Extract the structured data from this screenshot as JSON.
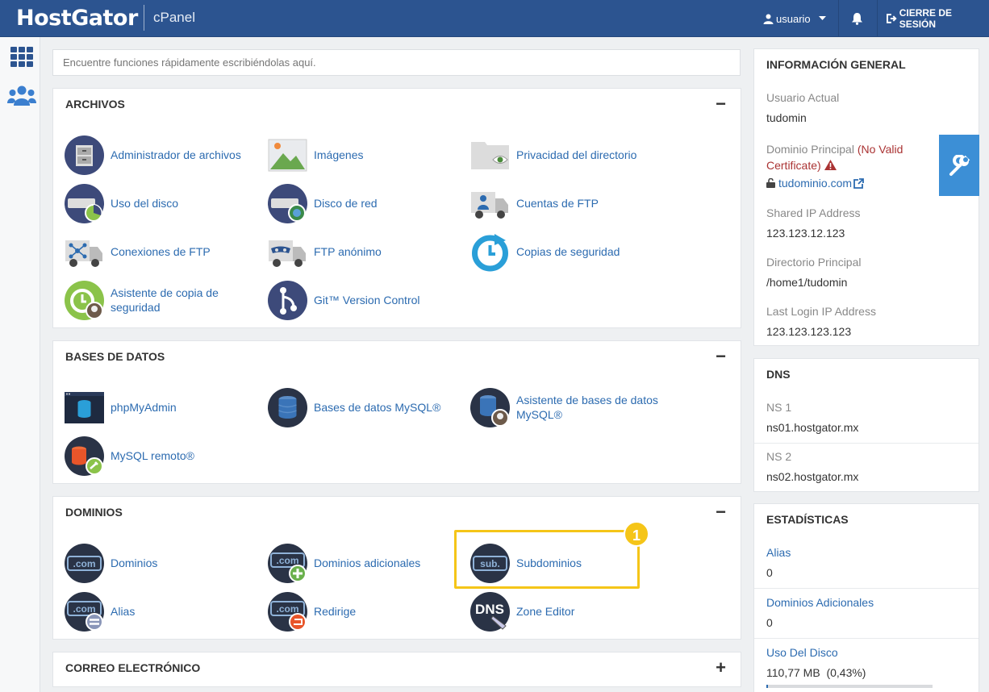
{
  "topbar": {
    "brand": "HostGator",
    "product": "cPanel",
    "user_label": "usuario",
    "logout_label": "CIERRE DE SESIÓN"
  },
  "search": {
    "placeholder": "Encuentre funciones rápidamente escribiéndolas aquí."
  },
  "sections": {
    "archivos": {
      "title": "ARCHIVOS",
      "toggle": "−",
      "items": [
        {
          "label": "Administrador de archivos",
          "icon": "file-manager-icon"
        },
        {
          "label": "Imágenes",
          "icon": "images-icon"
        },
        {
          "label": "Privacidad del directorio",
          "icon": "directory-privacy-icon"
        },
        {
          "label": "Uso del disco",
          "icon": "disk-usage-icon"
        },
        {
          "label": "Disco de red",
          "icon": "web-disk-icon"
        },
        {
          "label": "Cuentas de FTP",
          "icon": "ftp-accounts-icon"
        },
        {
          "label": "Conexiones de FTP",
          "icon": "ftp-connections-icon"
        },
        {
          "label": "FTP anónimo",
          "icon": "anonymous-ftp-icon"
        },
        {
          "label": "Copias de seguridad",
          "icon": "backup-icon"
        },
        {
          "label": "Asistente de copia de seguridad",
          "icon": "backup-wizard-icon"
        },
        {
          "label": "Git™ Version Control",
          "icon": "git-icon"
        }
      ]
    },
    "bases": {
      "title": "BASES DE DATOS",
      "toggle": "−",
      "items": [
        {
          "label": "phpMyAdmin",
          "icon": "phpmyadmin-icon"
        },
        {
          "label": "Bases de datos MySQL®",
          "icon": "mysql-databases-icon"
        },
        {
          "label": "Asistente de bases de datos MySQL®",
          "icon": "mysql-wizard-icon"
        },
        {
          "label": "MySQL remoto®",
          "icon": "remote-mysql-icon"
        }
      ]
    },
    "dominios": {
      "title": "DOMINIOS",
      "toggle": "−",
      "items": [
        {
          "label": "Dominios",
          "icon": "domains-icon",
          "text": ".com"
        },
        {
          "label": "Dominios adicionales",
          "icon": "addon-domains-icon",
          "text": ".com"
        },
        {
          "label": "Subdominios",
          "icon": "subdomains-icon",
          "text": "sub."
        },
        {
          "label": "Alias",
          "icon": "aliases-icon",
          "text": ".com"
        },
        {
          "label": "Redirige",
          "icon": "redirects-icon",
          "text": ".com"
        },
        {
          "label": "Zone Editor",
          "icon": "zone-editor-icon",
          "text": "DNS"
        }
      ]
    },
    "correo": {
      "title": "CORREO ELECTRÓNICO",
      "toggle": "+"
    }
  },
  "highlight_badge": "1",
  "general_info": {
    "title": "INFORMACIÓN GENERAL",
    "current_user_label": "Usuario Actual",
    "current_user": "tudomin",
    "main_domain_label": "Dominio Principal",
    "cert_warning": "(No Valid Certificate)",
    "main_domain": "tudominio.com",
    "shared_ip_label": "Shared IP Address",
    "shared_ip": "123.123.12.123",
    "home_dir_label": "Directorio Principal",
    "home_dir": "/home1/tudomin",
    "last_login_label": "Last Login IP Address",
    "last_login": "123.123.123.123"
  },
  "dns": {
    "title": "DNS",
    "ns1_label": "NS 1",
    "ns1": "ns01.hostgator.mx",
    "ns2_label": "NS 2",
    "ns2": "ns02.hostgator.mx"
  },
  "stats": {
    "title": "ESTADÍSTICAS",
    "aliases_label": "Alias",
    "aliases": "0",
    "addon_label": "Dominios Adicionales",
    "addon": "0",
    "disk_label": "Uso Del Disco",
    "disk_value": "110,77 MB",
    "disk_pct": "(0,43%)",
    "disk_fraction": 0.0043
  },
  "colors": {
    "topbar": "#2c5490",
    "link": "#2c6bb0",
    "highlight": "#f5c518",
    "tool": "#3c8fd6"
  }
}
